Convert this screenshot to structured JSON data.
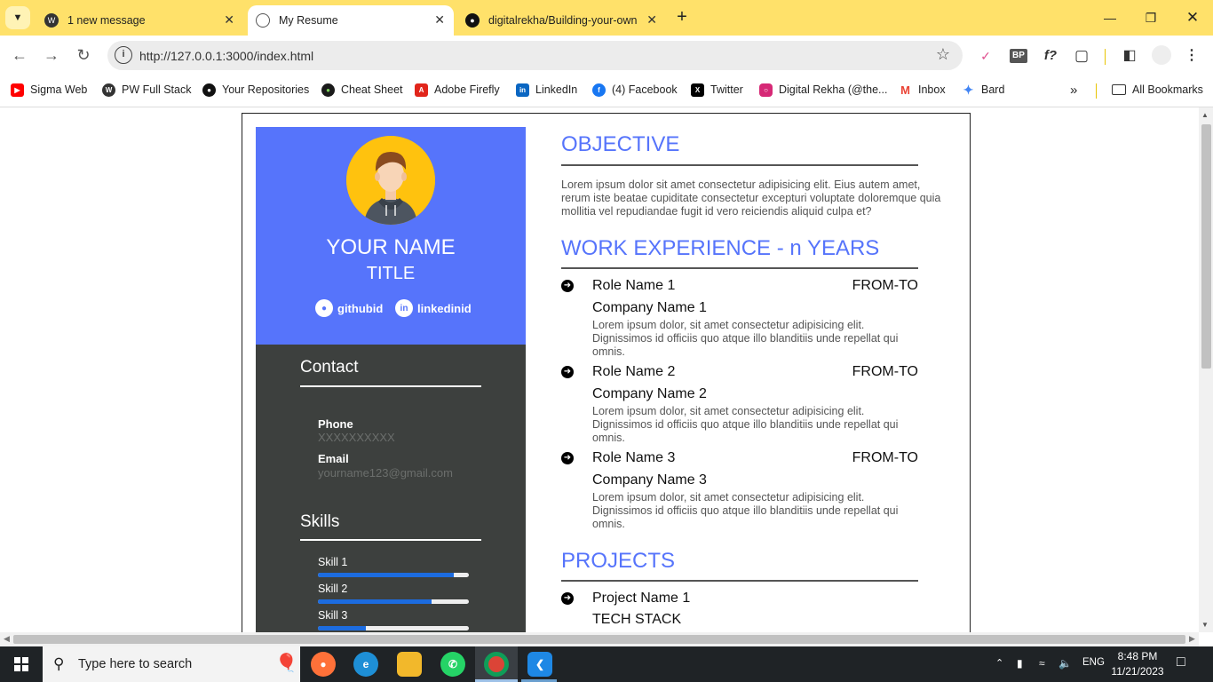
{
  "browser": {
    "tabs": [
      {
        "title": "1 new message",
        "icon": "wordpress-icon"
      },
      {
        "title": "My Resume",
        "icon": "globe-icon",
        "active": true
      },
      {
        "title": "digitalrekha/Building-your-own",
        "icon": "github-icon"
      }
    ],
    "url": "http://127.0.0.1:3000/index.html",
    "bookmarks": [
      {
        "label": "Sigma Web",
        "icon": "youtube-icon",
        "color": "#ff0000"
      },
      {
        "label": "PW Full Stack",
        "icon": "wordpress-icon",
        "color": "#333333"
      },
      {
        "label": "Your Repositories",
        "icon": "github-icon",
        "color": "#111111"
      },
      {
        "label": "Cheat Sheet",
        "icon": "cheat-sheet-icon",
        "color": "#1a1a1a"
      },
      {
        "label": "Adobe Firefly",
        "icon": "adobe-icon",
        "color": "#e1251b"
      },
      {
        "label": "LinkedIn",
        "icon": "linkedin-icon",
        "color": "#0a66c2"
      },
      {
        "label": "(4) Facebook",
        "icon": "facebook-icon",
        "color": "#1877f2"
      },
      {
        "label": "Twitter",
        "icon": "x-icon",
        "color": "#000000"
      },
      {
        "label": "Digital Rekha (@the...",
        "icon": "instagram-icon",
        "color": "#d62976"
      },
      {
        "label": "Inbox",
        "icon": "gmail-icon",
        "color": "#ea4335"
      },
      {
        "label": "Bard",
        "icon": "bard-icon",
        "color": "#4285f4"
      }
    ],
    "all_bookmarks": "All Bookmarks",
    "chrome_color": "#ffe16a"
  },
  "resume": {
    "name": "YOUR NAME",
    "title": "TITLE",
    "github": "githubid",
    "linkedin": "linkedinid",
    "accent": "#5674fb",
    "sidebar_color": "#3d403e",
    "contact_heading": "Contact",
    "phone_label": "Phone",
    "phone_value": "XXXXXXXXXX",
    "email_label": "Email",
    "email_value": "yourname123@gmail.com",
    "skills_heading": "Skills",
    "skills": [
      {
        "name": "Skill 1",
        "level": 0.9
      },
      {
        "name": "Skill 2",
        "level": 0.75
      },
      {
        "name": "Skill 3",
        "level": 0.32
      }
    ],
    "objective_heading": "OBJECTIVE",
    "objective_text": "Lorem ipsum dolor sit amet consectetur adipisicing elit. Eius autem amet, rerum iste beatae cupiditate consectetur excepturi voluptate doloremque quia mollitia vel repudiandae fugit id vero reiciendis aliquid culpa et?",
    "work_heading": "WORK EXPERIENCE - n YEARS",
    "jobs": [
      {
        "role": "Role Name 1",
        "dates": "FROM-TO",
        "company": "Company Name 1",
        "desc": "Lorem ipsum dolor, sit amet consectetur adipisicing elit. Dignissimos id officiis quo atque illo blanditiis unde repellat qui omnis."
      },
      {
        "role": "Role Name 2",
        "dates": "FROM-TO",
        "company": "Company Name 2",
        "desc": "Lorem ipsum dolor, sit amet consectetur adipisicing elit. Dignissimos id officiis quo atque illo blanditiis unde repellat qui omnis."
      },
      {
        "role": "Role Name 3",
        "dates": "FROM-TO",
        "company": "Company Name 3",
        "desc": "Lorem ipsum dolor, sit amet consectetur adipisicing elit. Dignissimos id officiis quo atque illo blanditiis unde repellat qui omnis."
      }
    ],
    "projects_heading": "PROJECTS",
    "projects": [
      {
        "name": "Project Name 1",
        "stack": "TECH STACK"
      }
    ]
  },
  "taskbar": {
    "search_placeholder": "Type here to search",
    "language": "ENG",
    "time": "8:48 PM",
    "date": "11/21/2023"
  }
}
